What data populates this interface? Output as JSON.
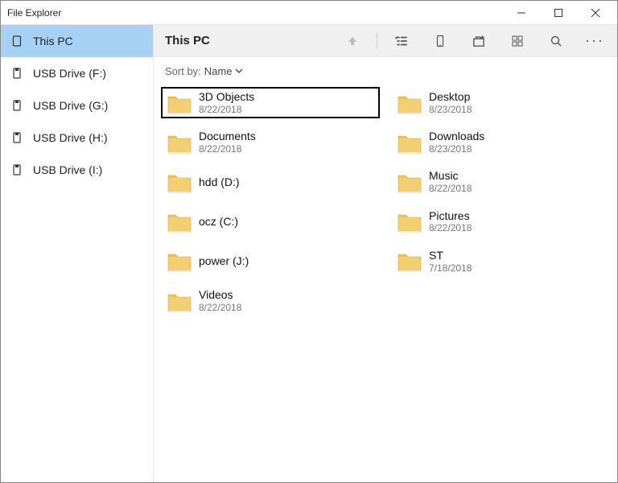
{
  "window": {
    "title": "File Explorer"
  },
  "sidebar": {
    "items": [
      {
        "label": "This PC",
        "icon": "device-icon",
        "selected": true
      },
      {
        "label": "USB Drive (F:)",
        "icon": "usb-drive-icon",
        "selected": false
      },
      {
        "label": "USB Drive (G:)",
        "icon": "usb-drive-icon",
        "selected": false
      },
      {
        "label": "USB Drive (H:)",
        "icon": "usb-drive-icon",
        "selected": false
      },
      {
        "label": "USB Drive (I:)",
        "icon": "usb-drive-icon",
        "selected": false
      }
    ]
  },
  "toolbar": {
    "location": "This PC",
    "up_icon": "arrow-up-icon",
    "list_icon": "list-view-icon",
    "phone_icon": "phone-icon",
    "new_icon": "new-item-icon",
    "grid_icon": "grid-view-icon",
    "search_icon": "search-icon",
    "more_icon": "more-icon"
  },
  "sort": {
    "label": "Sort by:",
    "field": "Name"
  },
  "folders": [
    {
      "name": "3D Objects",
      "date": "8/22/2018",
      "selected": true
    },
    {
      "name": "Desktop",
      "date": "8/23/2018",
      "selected": false
    },
    {
      "name": "Documents",
      "date": "8/22/2018",
      "selected": false
    },
    {
      "name": "Downloads",
      "date": "8/23/2018",
      "selected": false
    },
    {
      "name": "hdd (D:)",
      "date": "",
      "selected": false
    },
    {
      "name": "Music",
      "date": "8/22/2018",
      "selected": false
    },
    {
      "name": "ocz (C:)",
      "date": "",
      "selected": false
    },
    {
      "name": "Pictures",
      "date": "8/22/2018",
      "selected": false
    },
    {
      "name": "power (J:)",
      "date": "",
      "selected": false
    },
    {
      "name": "ST",
      "date": "7/18/2018",
      "selected": false
    },
    {
      "name": "Videos",
      "date": "8/22/2018",
      "selected": false
    }
  ]
}
